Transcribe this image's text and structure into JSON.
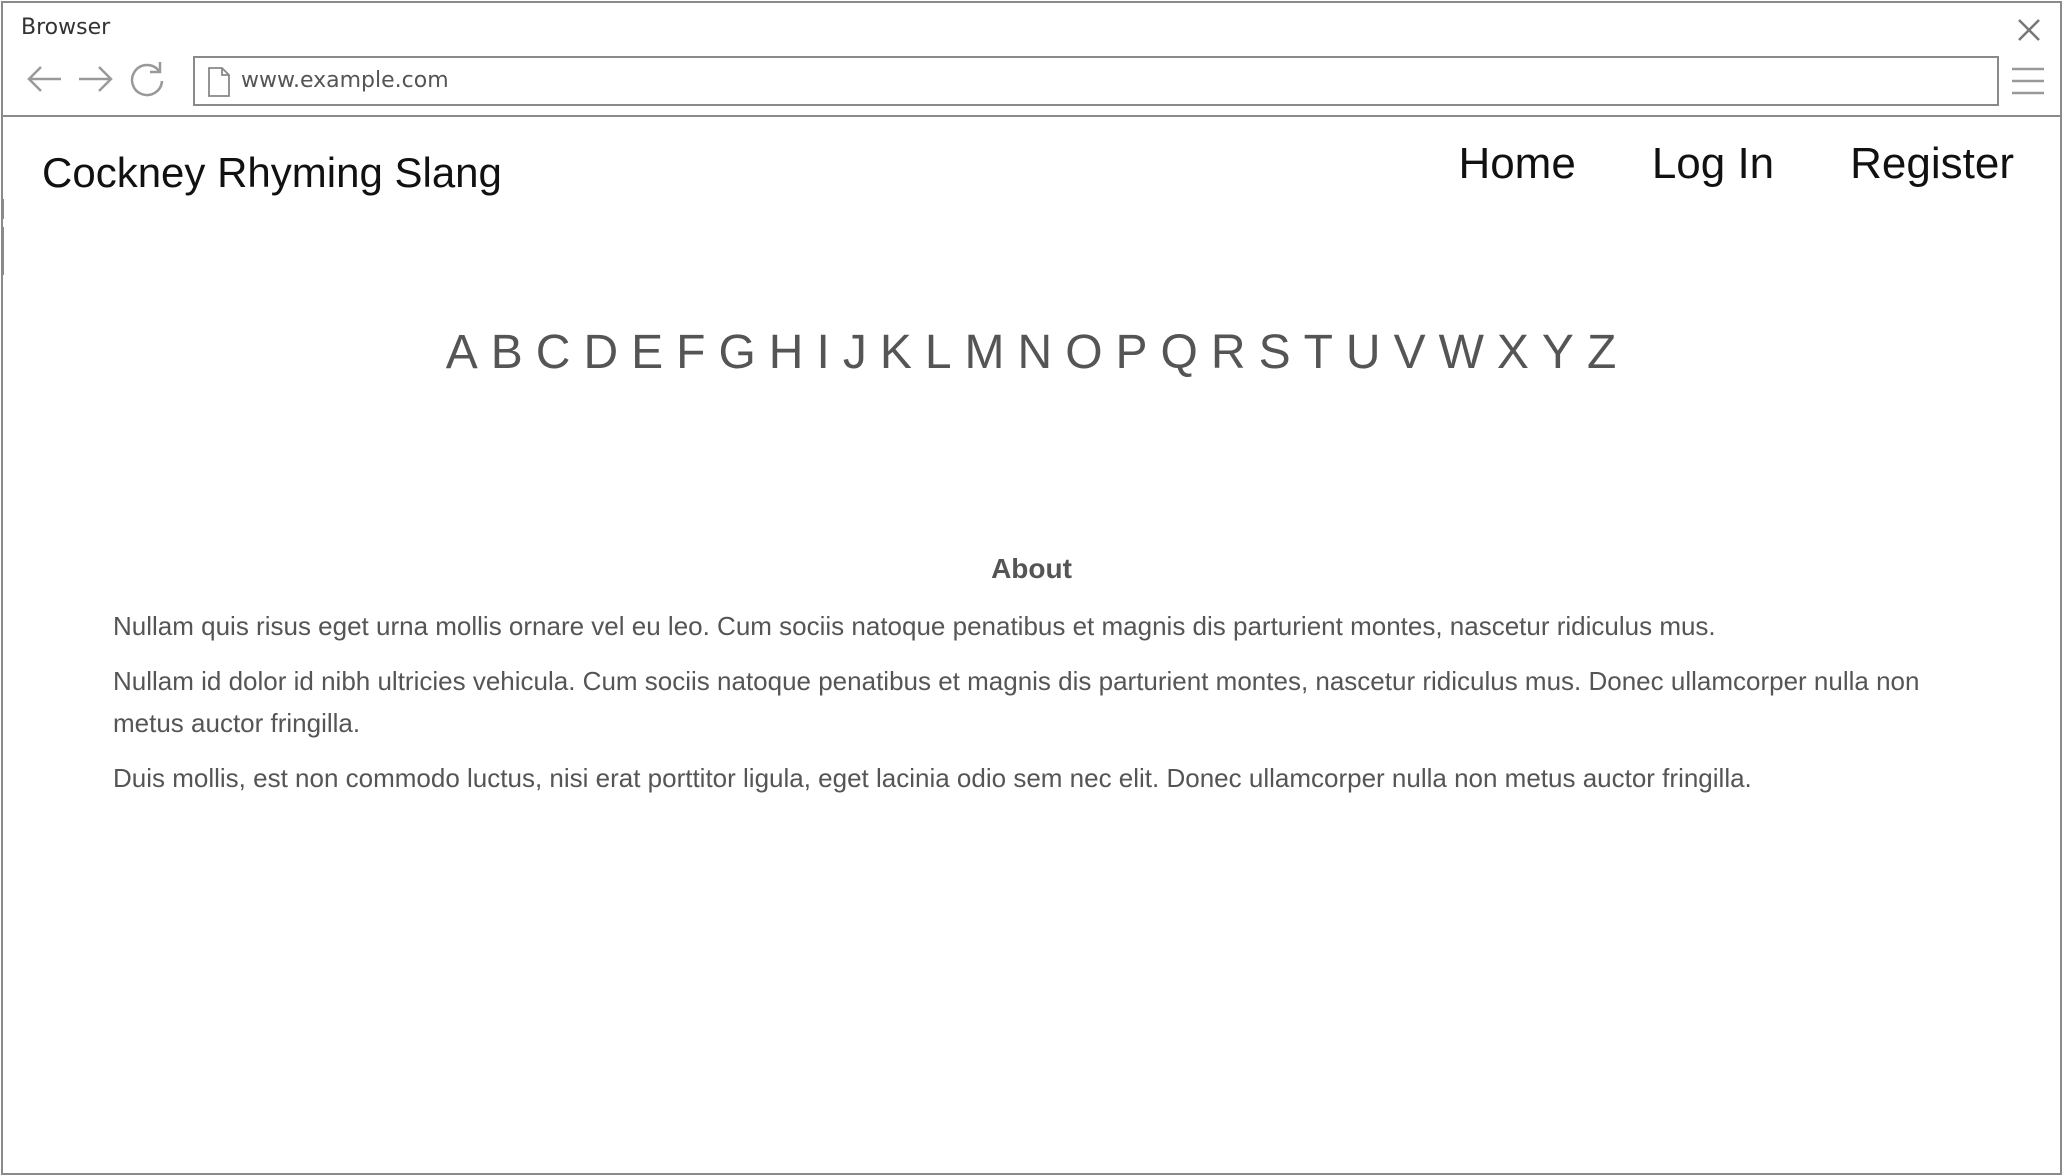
{
  "browser": {
    "window_title": "Browser",
    "address": "www.example.com"
  },
  "site": {
    "title": "Cockney Rhyming Slang",
    "nav": [
      {
        "label": "Home"
      },
      {
        "label": "Log In"
      },
      {
        "label": "Register"
      }
    ]
  },
  "alphabet": [
    "A",
    "B",
    "C",
    "D",
    "E",
    "F",
    "G",
    "H",
    "I",
    "J",
    "K",
    "L",
    "M",
    "N",
    "O",
    "P",
    "Q",
    "R",
    "S",
    "T",
    "U",
    "V",
    "W",
    "X",
    "Y",
    "Z"
  ],
  "about": {
    "heading": "About",
    "paragraphs": [
      "Nullam quis risus eget urna mollis ornare vel eu leo. Cum sociis natoque penatibus et magnis dis parturient montes, nascetur ridiculus mus.",
      "Nullam id dolor id nibh ultricies vehicula. Cum sociis natoque penatibus et magnis dis parturient montes, nascetur ridiculus mus. Donec ullamcorper nulla non metus auctor fringilla.",
      "Duis mollis, est non commodo luctus, nisi erat porttitor ligula, eget lacinia odio sem nec elit. Donec ullamcorper nulla non metus auctor fringilla."
    ]
  },
  "icons": {
    "close": "close-icon",
    "back": "arrow-left-icon",
    "forward": "arrow-right-icon",
    "reload": "reload-icon",
    "page": "page-icon",
    "menu": "hamburger-menu-icon"
  },
  "colors": {
    "border": "#8a8a8a",
    "text_dark": "#111111",
    "text_muted": "#555555"
  }
}
